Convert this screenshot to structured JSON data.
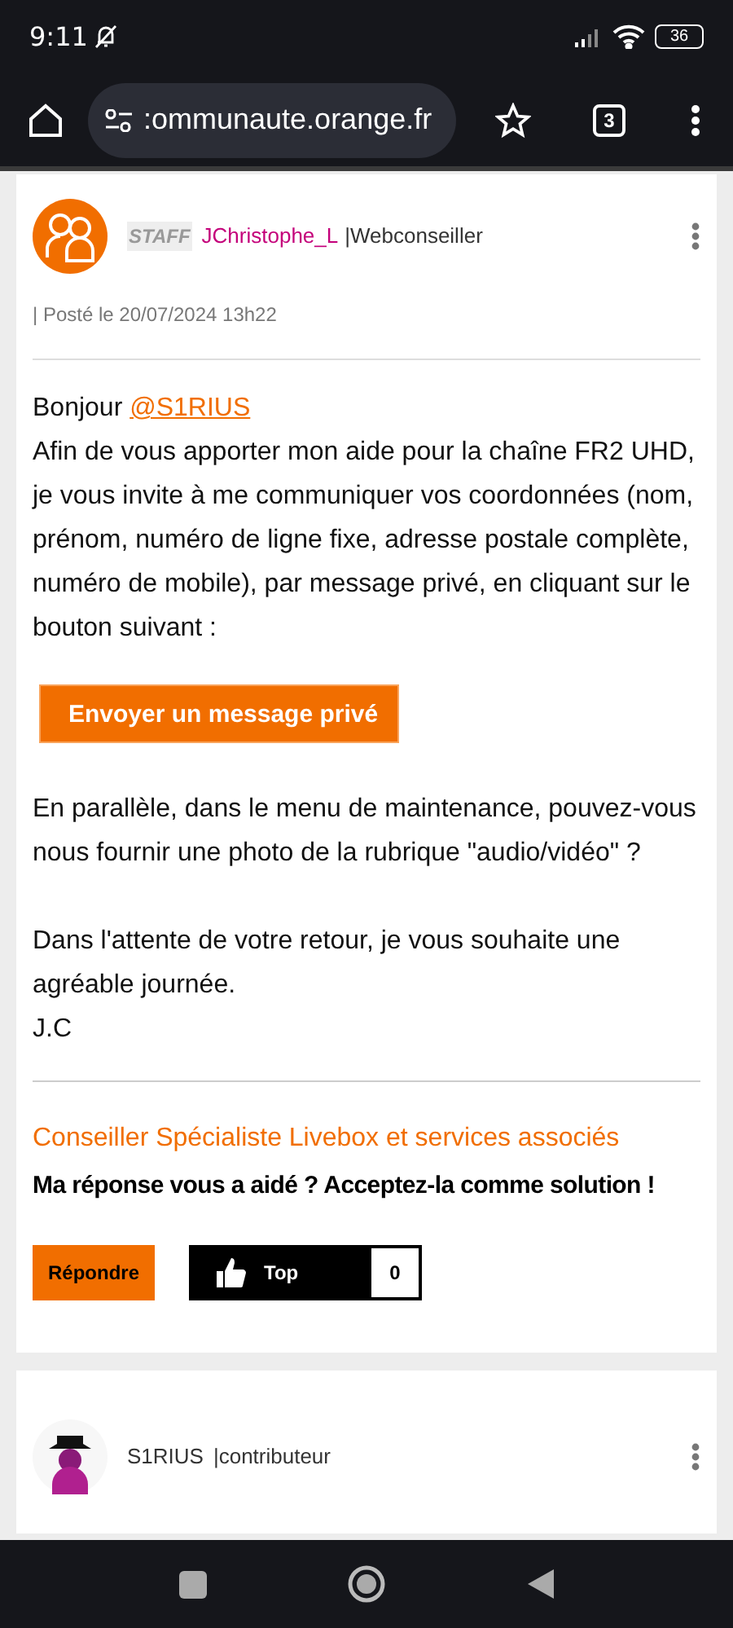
{
  "status_bar": {
    "time": "9:11",
    "battery": "36"
  },
  "browser": {
    "url": ":ommunaute.orange.fr",
    "tab_count": "3"
  },
  "posts": [
    {
      "badge": "STAFF",
      "author": "JChristophe_L",
      "role": "|Webconseiller",
      "date": "| Posté le 20/07/2024 13h22",
      "body": [
        {
          "kind": "greeting",
          "text": "Bonjour",
          "mention": "@S1RIUS"
        },
        {
          "kind": "line",
          "text": "Afin de vous apporter mon aide pour la chaîne FR2 UHD, je vous invite à me communiquer vos coordonnées (nom, prénom, numéro de ligne fixe, adresse postale complète, numéro de mobile), par message privé, en cliquant sur le bouton suivant :"
        },
        {
          "kind": "button",
          "text": "Envoyer un message privé"
        },
        {
          "kind": "paragraph",
          "text": "En parallèle, dans le menu de maintenance, pouvez-vous nous fournir une photo de la rubrique \"audio/vidéo\" ?"
        },
        {
          "kind": "paragraph",
          "text": "Dans l'attente de votre retour, je vous souhaite une agréable journée."
        },
        {
          "kind": "line",
          "text": "J.C"
        }
      ],
      "signature_title": "Conseiller Spécialiste Livebox et services associés",
      "signature_note": "Ma réponse vous a aidé ? Acceptez-la comme solution !",
      "reply_label": "Répondre",
      "kudos_label": "Top",
      "kudos_count": "0"
    },
    {
      "author": "S1RIUS",
      "role": "|contributeur"
    }
  ]
}
